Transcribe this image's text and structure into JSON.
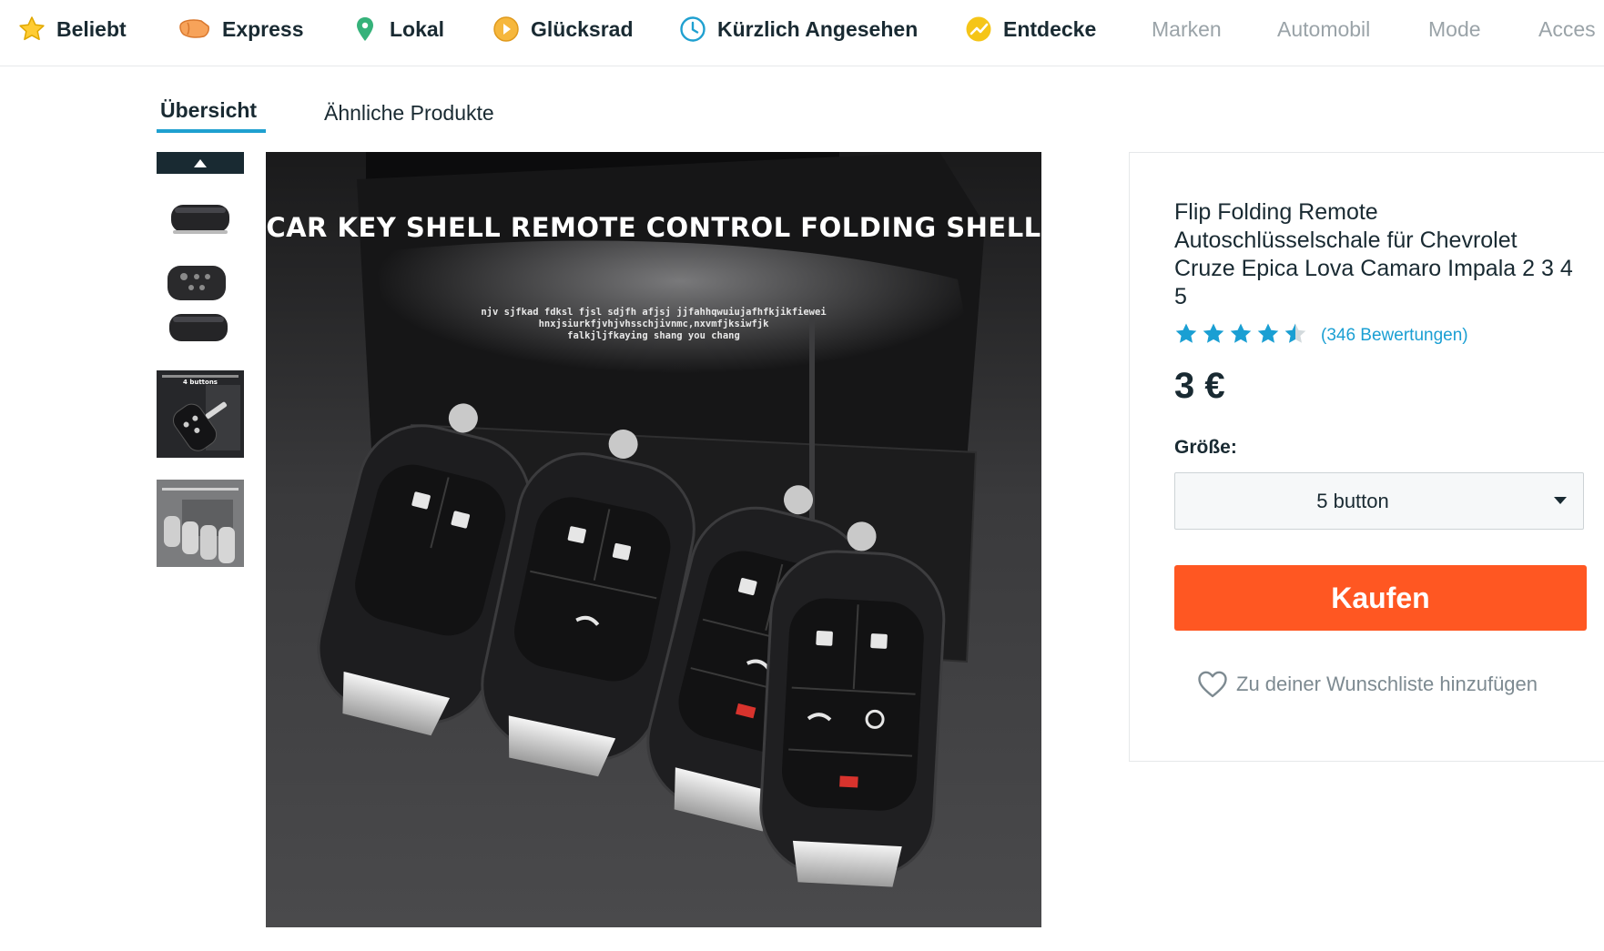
{
  "nav": {
    "items": [
      {
        "label": "Beliebt",
        "icon": "star-icon"
      },
      {
        "label": "Express",
        "icon": "truck-icon"
      },
      {
        "label": "Lokal",
        "icon": "location-pin-icon"
      },
      {
        "label": "Glücksrad",
        "icon": "wheel-icon"
      },
      {
        "label": "Kürzlich Angesehen",
        "icon": "clock-icon"
      },
      {
        "label": "Entdecke",
        "icon": "trend-icon"
      },
      {
        "label": "Marken"
      },
      {
        "label": "Automobil"
      },
      {
        "label": "Mode"
      },
      {
        "label": "Acces"
      }
    ]
  },
  "tabs": [
    {
      "label": "Übersicht",
      "active": true
    },
    {
      "label": "Ähnliche Produkte",
      "active": false
    }
  ],
  "gallery": {
    "thumbnail_text": "4 buttons",
    "main_image": {
      "headline": "CAR KEY SHELL REMOTE CONTROL FOLDING SHELL",
      "fine_print": [
        "njv sjfkad fdksl fjsl sdjfh afjsj jjfahhqwuiujafhfkjikfiewei",
        "hnxjsiurkfjvhjvhsschjivnmc,nxvmfjksiwfjk",
        "falkjljfkaying shang you chang"
      ]
    }
  },
  "product": {
    "title": "Flip Folding Remote Autoschlüsselschale für Chevrolet Cruze Epica Lova Camaro Impala 2 3 4 5",
    "rating": 4.5,
    "reviews": "(346 Bewertungen)",
    "price": "3 €",
    "size_label": "Größe:",
    "size_value": "5 button",
    "buy_label": "Kaufen",
    "wishlist_label": "Zu deiner Wunschliste hinzufügen"
  },
  "colors": {
    "accent_blue": "#1fa0d0",
    "buy_orange": "#ff5722",
    "star_blue": "#1a9fd3",
    "text_dark": "#192a32"
  }
}
